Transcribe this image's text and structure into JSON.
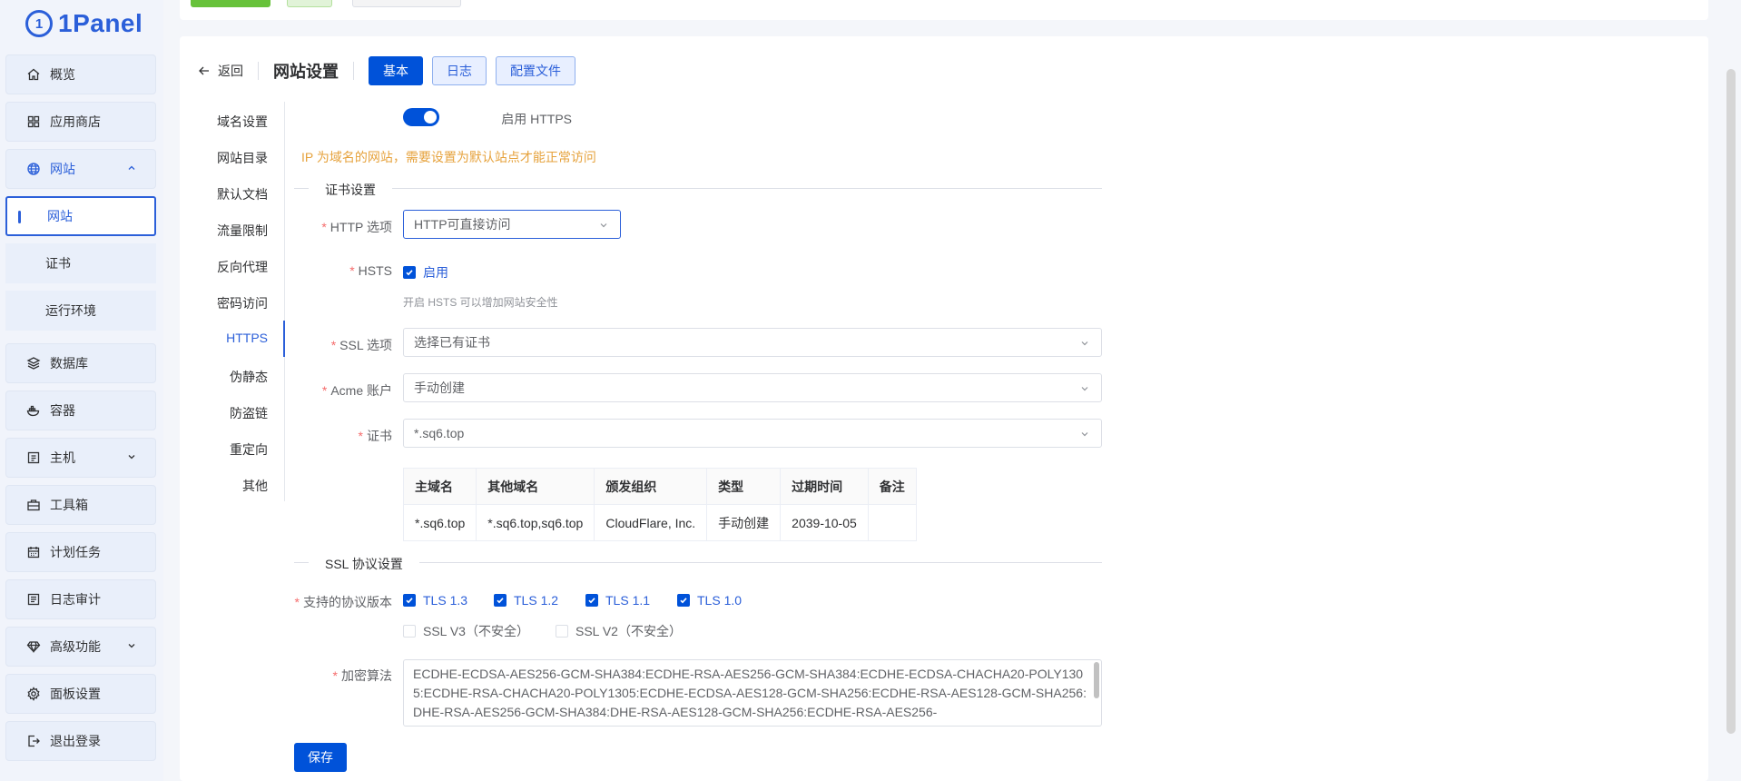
{
  "app": {
    "logo_text": "1Panel"
  },
  "sidebar": {
    "items": [
      {
        "label": "概览",
        "icon": "home-icon"
      },
      {
        "label": "应用商店",
        "icon": "grid-icon"
      },
      {
        "label": "网站",
        "icon": "globe-icon"
      },
      {
        "label": "数据库",
        "icon": "layers-icon"
      },
      {
        "label": "容器",
        "icon": "docker-icon"
      },
      {
        "label": "主机",
        "icon": "server-icon"
      },
      {
        "label": "工具箱",
        "icon": "toolbox-icon"
      },
      {
        "label": "计划任务",
        "icon": "calendar-icon"
      },
      {
        "label": "日志审计",
        "icon": "log-icon"
      },
      {
        "label": "高级功能",
        "icon": "diamond-icon"
      },
      {
        "label": "面板设置",
        "icon": "gear-icon"
      },
      {
        "label": "退出登录",
        "icon": "logout-icon"
      }
    ],
    "sub_items": [
      {
        "label": "网站"
      },
      {
        "label": "证书"
      },
      {
        "label": "运行环境"
      }
    ]
  },
  "header": {
    "back_label": "返回",
    "title": "网站设置",
    "tabs": [
      {
        "label": "基本"
      },
      {
        "label": "日志"
      },
      {
        "label": "配置文件"
      }
    ]
  },
  "side_tabs": [
    "域名设置",
    "网站目录",
    "默认文档",
    "流量限制",
    "反向代理",
    "密码访问",
    "HTTPS",
    "伪静态",
    "防盗链",
    "重定向",
    "其他"
  ],
  "form": {
    "enable_https_label": "启用 HTTPS",
    "warning": "IP 为域名的网站，需要设置为默认站点才能正常访问",
    "cert_section": "证书设置",
    "http_option_label": "HTTP 选项",
    "http_option_value": "HTTP可直接访问",
    "hsts_label": "HSTS",
    "hsts_checkbox": "启用",
    "hsts_hint": "开启 HSTS 可以增加网站安全性",
    "ssl_option_label": "SSL 选项",
    "ssl_option_value": "选择已有证书",
    "acme_label": "Acme 账户",
    "acme_value": "手动创建",
    "cert_label": "证书",
    "cert_value": "*.sq6.top",
    "cert_table": {
      "headers": [
        "主域名",
        "其他域名",
        "颁发组织",
        "类型",
        "过期时间",
        "备注"
      ],
      "row": [
        "*.sq6.top",
        "*.sq6.top,sq6.top",
        "CloudFlare, Inc.",
        "手动创建",
        "2039-10-05",
        ""
      ]
    },
    "ssl_section": "SSL 协议设置",
    "protocols_label": "支持的协议版本",
    "protocols": [
      {
        "label": "TLS 1.3",
        "checked": true
      },
      {
        "label": "TLS 1.2",
        "checked": true
      },
      {
        "label": "TLS 1.1",
        "checked": true
      },
      {
        "label": "TLS 1.0",
        "checked": true
      },
      {
        "label": "SSL V3（不安全）",
        "checked": false
      },
      {
        "label": "SSL V2（不安全）",
        "checked": false
      }
    ],
    "cipher_label": "加密算法",
    "cipher_value": "ECDHE-ECDSA-AES256-GCM-SHA384:ECDHE-RSA-AES256-GCM-SHA384:ECDHE-ECDSA-CHACHA20-POLY1305:ECDHE-RSA-CHACHA20-POLY1305:ECDHE-ECDSA-AES128-GCM-SHA256:ECDHE-RSA-AES128-GCM-SHA256:DHE-RSA-AES256-GCM-SHA384:DHE-RSA-AES128-GCM-SHA256:ECDHE-RSA-AES256-",
    "save_label": "保存"
  },
  "colors": {
    "accent": "#0052d9",
    "warning": "#e6a23c",
    "required": "#f56c6c"
  }
}
